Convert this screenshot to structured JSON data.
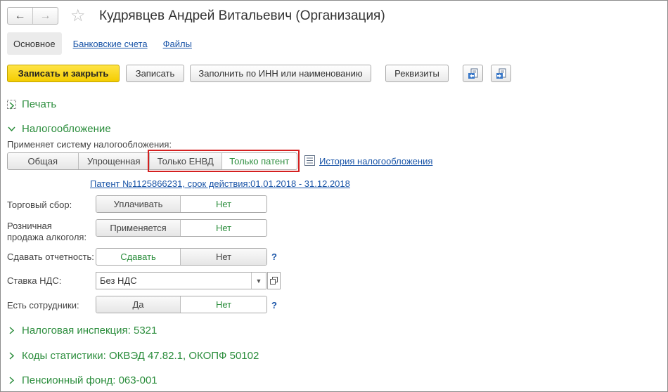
{
  "window": {
    "title": "Кудрявцев Андрей Витальевич (Организация)",
    "nav_back": "←",
    "nav_forward": "→",
    "favorite_icon": "star-icon"
  },
  "tabs": [
    {
      "label": "Основное",
      "active": true
    },
    {
      "label": "Банковские счета",
      "active": false
    },
    {
      "label": "Файлы",
      "active": false
    }
  ],
  "toolbar": {
    "save_close": "Записать и закрыть",
    "save": "Записать",
    "fill_inn": "Заполнить по ИНН или наименованию",
    "requisites": "Реквизиты",
    "icon1": "document-arrow-left-icon",
    "icon2": "document-arrow-right-icon"
  },
  "sections": {
    "print": "Печать",
    "taxation": "Налогообложение",
    "tax_inspection": "Налоговая инспекция: 5321",
    "stat_codes": "Коды статистики: ОКВЭД 47.82.1, ОКОПФ 50102",
    "pension_fund": "Пенсионный фонд: 063-001"
  },
  "taxation": {
    "system_label": "Применяет систему налогообложения:",
    "systems": [
      "Общая",
      "Упрощенная",
      "Только ЕНВД",
      "Только патент"
    ],
    "selected_system": "Только патент",
    "history_link": "История налогообложения",
    "patent_link": "Патент №1125866231, срок действия:01.01.2018 - 31.12.2018",
    "trade_fee": {
      "label": "Торговый сбор:",
      "options": [
        "Уплачивать",
        "Нет"
      ],
      "selected": "Нет"
    },
    "alcohol": {
      "label_line1": "Розничная",
      "label_line2": "продажа алкоголя:",
      "options": [
        "Применяется",
        "Нет"
      ],
      "selected": "Нет"
    },
    "reporting": {
      "label": "Сдавать отчетность:",
      "options": [
        "Сдавать",
        "Нет"
      ],
      "selected": "Сдавать",
      "help": "?"
    },
    "vat": {
      "label": "Ставка НДС:",
      "value": "Без НДС"
    },
    "employees": {
      "label": "Есть сотрудники:",
      "options": [
        "Да",
        "Нет"
      ],
      "selected": "Нет",
      "help": "?"
    }
  },
  "colors": {
    "accent_green": "#2b8d3c",
    "link_blue": "#1a55a8",
    "primary_yellow": "#f4cd00",
    "highlight_red": "#d42020"
  }
}
